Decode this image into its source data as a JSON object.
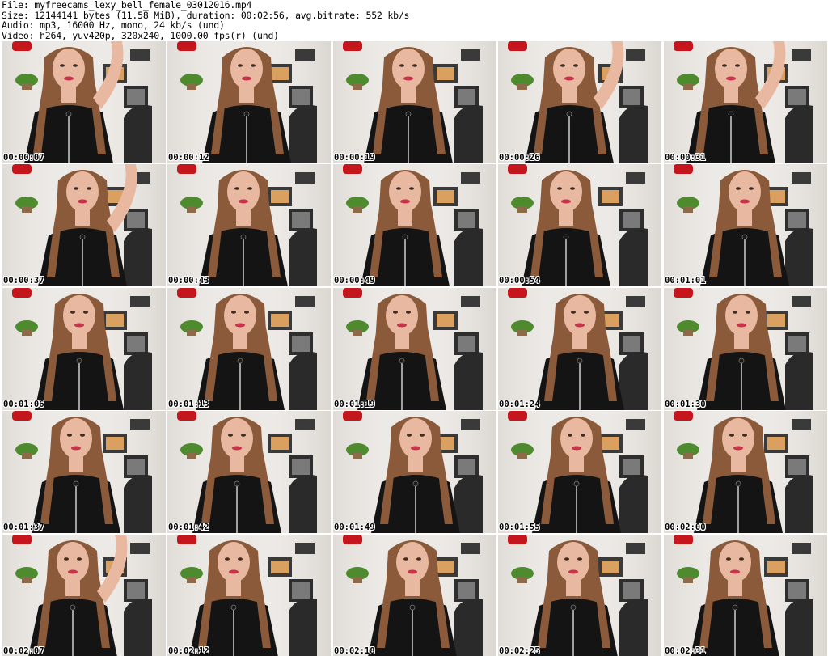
{
  "header": {
    "file_line": "File: myfreecams_lexy_bell_female_03012016.mp4",
    "size_line": "Size: 12144141 bytes (11.58 MiB), duration: 00:02:56, avg.bitrate: 552 kb/s",
    "audio_line": "Audio: mp3, 16000 Hz, mono, 24 kb/s (und)",
    "video_line": "Video: h264, yuv420p, 320x240, 1000.00 fps(r) (und)"
  },
  "frames": [
    {
      "timestamp": "00:00:07"
    },
    {
      "timestamp": "00:00:12"
    },
    {
      "timestamp": "00:00:19"
    },
    {
      "timestamp": "00:00:26"
    },
    {
      "timestamp": "00:00:31"
    },
    {
      "timestamp": "00:00:37"
    },
    {
      "timestamp": "00:00:43"
    },
    {
      "timestamp": "00:00:49"
    },
    {
      "timestamp": "00:00:54"
    },
    {
      "timestamp": "00:01:01"
    },
    {
      "timestamp": "00:01:06"
    },
    {
      "timestamp": "00:01:13"
    },
    {
      "timestamp": "00:01:19"
    },
    {
      "timestamp": "00:01:24"
    },
    {
      "timestamp": "00:01:30"
    },
    {
      "timestamp": "00:01:37"
    },
    {
      "timestamp": "00:01:42"
    },
    {
      "timestamp": "00:01:49"
    },
    {
      "timestamp": "00:01:55"
    },
    {
      "timestamp": "00:02:00"
    },
    {
      "timestamp": "00:02:07"
    },
    {
      "timestamp": "00:02:12"
    },
    {
      "timestamp": "00:02:18"
    },
    {
      "timestamp": "00:02:25"
    },
    {
      "timestamp": "00:02:31"
    }
  ],
  "colors": {
    "wall": "#ebe8e4",
    "dress": "#141414",
    "hair": "#8a5a3a",
    "skin": "#e8b8a0",
    "chair": "#2a2a2a",
    "pot_red": "#c4161c",
    "plant_green": "#4e8a2e"
  }
}
